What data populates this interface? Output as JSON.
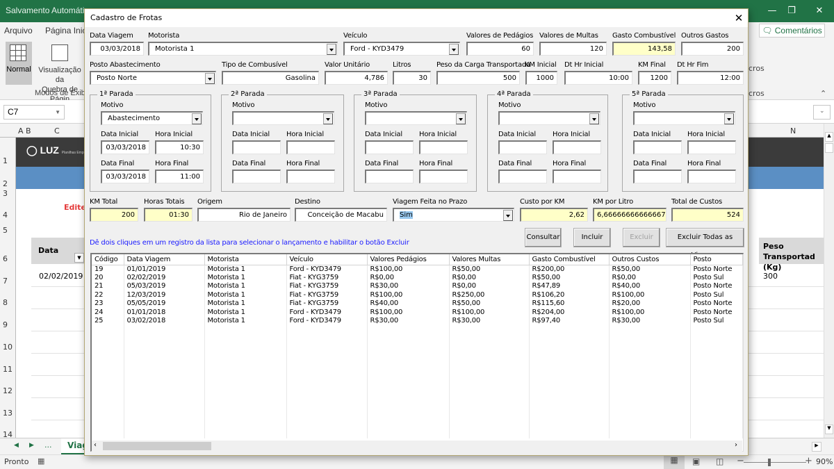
{
  "excel": {
    "title": "Salvamento Automático",
    "tabs": [
      "Arquivo",
      "Página Inic"
    ],
    "comments_label": "Comentários",
    "view_normal": "Normal",
    "view_pagebreak_line1": "Visualização da",
    "view_pagebreak_line2": "Quebra de Págin",
    "group_label": "Modos de Exibi",
    "macros_label": "cros",
    "macros_group": "cros",
    "name_box": "C7",
    "columns": [
      "A",
      "B",
      "C",
      "N"
    ],
    "rows": [
      "1",
      "2",
      "3",
      "4",
      "5",
      "6",
      "7",
      "8",
      "9",
      "10",
      "11",
      "12",
      "13",
      "14"
    ],
    "logo": "LUZ",
    "logo_sub": "Planilhas Empresariais",
    "edit_hint": "Edite a",
    "header_data": "Data",
    "header_peso": "Peso Transportad (Kg)",
    "cell_date": "02/02/2019",
    "cell_peso": "300",
    "sheet_tab": "Viag",
    "sheet_more": "...",
    "status": "Pronto",
    "zoom": "90%"
  },
  "dialog": {
    "title": "Cadastro de Frotas",
    "fields": {
      "data_viagem": {
        "label": "Data Viagem",
        "value": "03/03/2018"
      },
      "motorista": {
        "label": "Motorista",
        "value": "Motorista 1"
      },
      "veiculo": {
        "label": "Veículo",
        "value": "Ford - KYD3479"
      },
      "pedagios": {
        "label": "Valores de Pedágios",
        "value": "60"
      },
      "multas": {
        "label": "Valores de Multas",
        "value": "120"
      },
      "gasto_comb": {
        "label": "Gasto Combustível",
        "value": "143,58"
      },
      "outros": {
        "label": "Outros Gastos",
        "value": "200"
      },
      "posto": {
        "label": "Posto Abastecimento",
        "value": "Posto Norte"
      },
      "tipo_comb": {
        "label": "Tipo de Combusível",
        "value": "Gasolina"
      },
      "valor_unit": {
        "label": "Valor Unitário",
        "value": "4,786"
      },
      "litros": {
        "label": "Litros",
        "value": "30"
      },
      "peso_carga": {
        "label": "Peso da Carga Transportada",
        "value": "500"
      },
      "km_inicial": {
        "label": "KM Inicial",
        "value": "1000"
      },
      "dt_hr_inicial": {
        "label": "Dt Hr Inicial",
        "value": "10:00"
      },
      "km_final": {
        "label": "KM Final",
        "value": "1200"
      },
      "dt_hr_fim": {
        "label": "Dt Hr Fim",
        "value": "12:00"
      },
      "km_total": {
        "label": "KM Total",
        "value": "200"
      },
      "horas_totais": {
        "label": "Horas Totais",
        "value": "01:30"
      },
      "origem": {
        "label": "Origem",
        "value": "Rio de Janeiro"
      },
      "destino": {
        "label": "Destino",
        "value": "Conceição de Macabu"
      },
      "prazo": {
        "label": "Viagem Feita no Prazo",
        "value": "Sim"
      },
      "custo_km": {
        "label": "Custo por KM",
        "value": "2,62"
      },
      "km_litro": {
        "label": "KM por Litro",
        "value": "6,66666666666667"
      },
      "total_custos": {
        "label": "Total de Custos",
        "value": "524"
      }
    },
    "stop_labels": {
      "motivo": "Motivo",
      "data_inicial": "Data Inicial",
      "hora_inicial": "Hora Inicial",
      "data_final": "Data Final",
      "hora_final": "Hora Final"
    },
    "stops": [
      {
        "title": "1ª Parada",
        "motivo": "Abastecimento",
        "data_inicial": "03/03/2018",
        "hora_inicial": "10:30",
        "data_final": "03/03/2018",
        "hora_final": "11:00"
      },
      {
        "title": "2ª Parada",
        "motivo": "",
        "data_inicial": "",
        "hora_inicial": "",
        "data_final": "",
        "hora_final": ""
      },
      {
        "title": "3ª Parada",
        "motivo": "",
        "data_inicial": "",
        "hora_inicial": "",
        "data_final": "",
        "hora_final": ""
      },
      {
        "title": "4ª Parada",
        "motivo": "",
        "data_inicial": "",
        "hora_inicial": "",
        "data_final": "",
        "hora_final": ""
      },
      {
        "title": "5ª Parada",
        "motivo": "",
        "data_inicial": "",
        "hora_inicial": "",
        "data_final": "",
        "hora_final": ""
      }
    ],
    "hint": "Dê dois cliques em um registro da lista para selecionar o lançamento e habilitar o botão Excluir",
    "buttons": {
      "consultar": "Consultar",
      "incluir": "Incluir",
      "excluir": "Excluir",
      "excluir_todas": "Excluir Todas as Viagens"
    },
    "list": {
      "columns": [
        "Código",
        "Data Viagem",
        "Motorista",
        "Veículo",
        "Valores Pedágios",
        "Valores Multas",
        "Gasto Combustível",
        "Outros Custos",
        "Posto"
      ],
      "rows": [
        [
          "19",
          "01/01/2019",
          "Motorista 1",
          "Ford - KYD3479",
          "R$100,00",
          "R$50,00",
          "R$200,00",
          "R$50,00",
          "Posto Norte"
        ],
        [
          "20",
          "02/02/2019",
          "Motorista 1",
          "Fiat - KYG3759",
          "R$0,00",
          "R$0,00",
          "R$50,00",
          "R$0,00",
          "Posto Sul"
        ],
        [
          "21",
          "05/03/2019",
          "Motorista 1",
          "Fiat - KYG3759",
          "R$30,00",
          "R$0,00",
          "R$47,89",
          "R$40,00",
          "Posto Norte"
        ],
        [
          "22",
          "12/03/2019",
          "Motorista 1",
          "Fiat - KYG3759",
          "R$100,00",
          "R$250,00",
          "R$106,20",
          "R$100,00",
          "Posto Sul"
        ],
        [
          "23",
          "05/05/2019",
          "Motorista 1",
          "Fiat - KYG3759",
          "R$40,00",
          "R$50,00",
          "R$115,60",
          "R$20,00",
          "Posto Norte"
        ],
        [
          "24",
          "01/01/2018",
          "Motorista 1",
          "Ford - KYD3479",
          "R$100,00",
          "R$100,00",
          "R$204,00",
          "R$100,00",
          "Posto Norte"
        ],
        [
          "25",
          "03/02/2018",
          "Motorista 1",
          "Ford - KYD3479",
          "R$30,00",
          "R$30,00",
          "R$97,40",
          "R$30,00",
          "Posto Sul"
        ]
      ]
    }
  }
}
